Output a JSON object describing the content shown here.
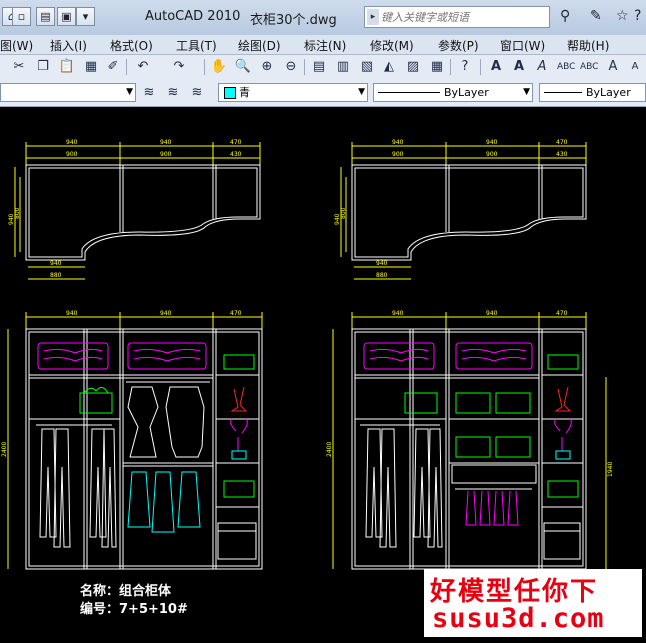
{
  "window": {
    "app_title": "AutoCAD 2010",
    "file_title": "衣柜30个.dwg",
    "search_placeholder": "键入关键字或短语"
  },
  "menu": [
    "图(W)",
    "插入(I)",
    "格式(O)",
    "工具(T)",
    "绘图(D)",
    "标注(N)",
    "修改(M)",
    "参数(P)",
    "窗口(W)",
    "帮助(H)"
  ],
  "properties_bar": {
    "color_value": "青",
    "linetype_value": "ByLayer",
    "lineweight_value": "ByLayer"
  },
  "drawing": {
    "dims_top": [
      "940",
      "940",
      "470"
    ],
    "dims_inner": [
      "900",
      "900",
      "430"
    ],
    "dims_side": [
      "940",
      "800"
    ],
    "dims_bottom": [
      "940",
      "880"
    ],
    "height_dim": "2400",
    "right_sub_dim": "1940",
    "caption_name": "名称：组合柜体",
    "caption_code": "编号：7+5+10#"
  },
  "watermark": {
    "line1": "好模型任你下",
    "line2": "susu3d.com"
  },
  "colors": {
    "dimension": "#ffff00",
    "outline": "#ffffff",
    "magenta": "#ff00ff",
    "green": "#00ff00",
    "red": "#ff2222",
    "cyan": "#00ffff"
  }
}
